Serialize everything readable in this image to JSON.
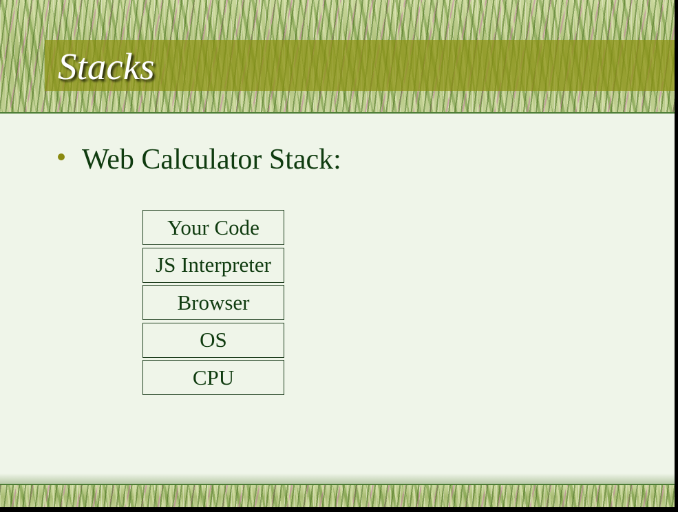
{
  "slide": {
    "title": "Stacks",
    "bullet": "Web Calculator Stack:",
    "stack_layers": [
      "Your Code",
      "JS Interpreter",
      "Browser",
      "OS",
      "CPU"
    ]
  },
  "colors": {
    "background": "#eff5e9",
    "title_band": "#8c9114",
    "text": "#0f3b0f",
    "bullet": "#8a8a10",
    "title_text": "#ffffff"
  }
}
